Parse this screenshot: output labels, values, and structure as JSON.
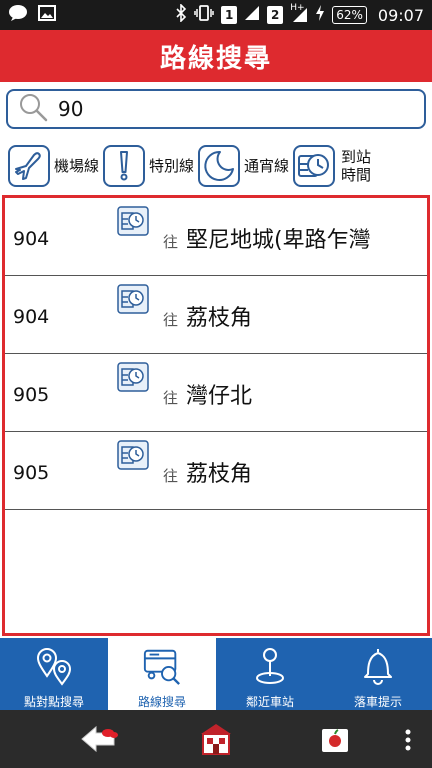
{
  "status_bar": {
    "sim1": "1",
    "sim2": "2",
    "network": "H+",
    "battery": "62%",
    "time": "09:07"
  },
  "header": {
    "title": "路線搜尋"
  },
  "search": {
    "value": "90",
    "placeholder": ""
  },
  "filters": [
    {
      "label": "機場線",
      "icon": "airplane-icon"
    },
    {
      "label": "特別線",
      "icon": "exclamation-icon"
    },
    {
      "label": "通宵線",
      "icon": "moon-icon"
    },
    {
      "label_line1": "到站",
      "label_line2": "時間",
      "icon": "bus-clock-icon"
    }
  ],
  "routes": [
    {
      "number": "904",
      "prefix": "往",
      "destination": "堅尼地城(卑路乍灣"
    },
    {
      "number": "904",
      "prefix": "往",
      "destination": "荔枝角"
    },
    {
      "number": "905",
      "prefix": "往",
      "destination": "灣仔北"
    },
    {
      "number": "905",
      "prefix": "往",
      "destination": "荔枝角"
    }
  ],
  "tabs": [
    {
      "label": "點對點搜尋",
      "icon": "location-pins-icon"
    },
    {
      "label": "路線搜尋",
      "icon": "route-search-icon",
      "active": true
    },
    {
      "label": "鄰近車站",
      "icon": "nearby-stop-icon"
    },
    {
      "label": "落車提示",
      "icon": "bell-icon"
    }
  ],
  "colors": {
    "header_red": "#de2a2f",
    "tab_blue": "#1f63b0",
    "icon_blue": "#2e5e9a"
  }
}
